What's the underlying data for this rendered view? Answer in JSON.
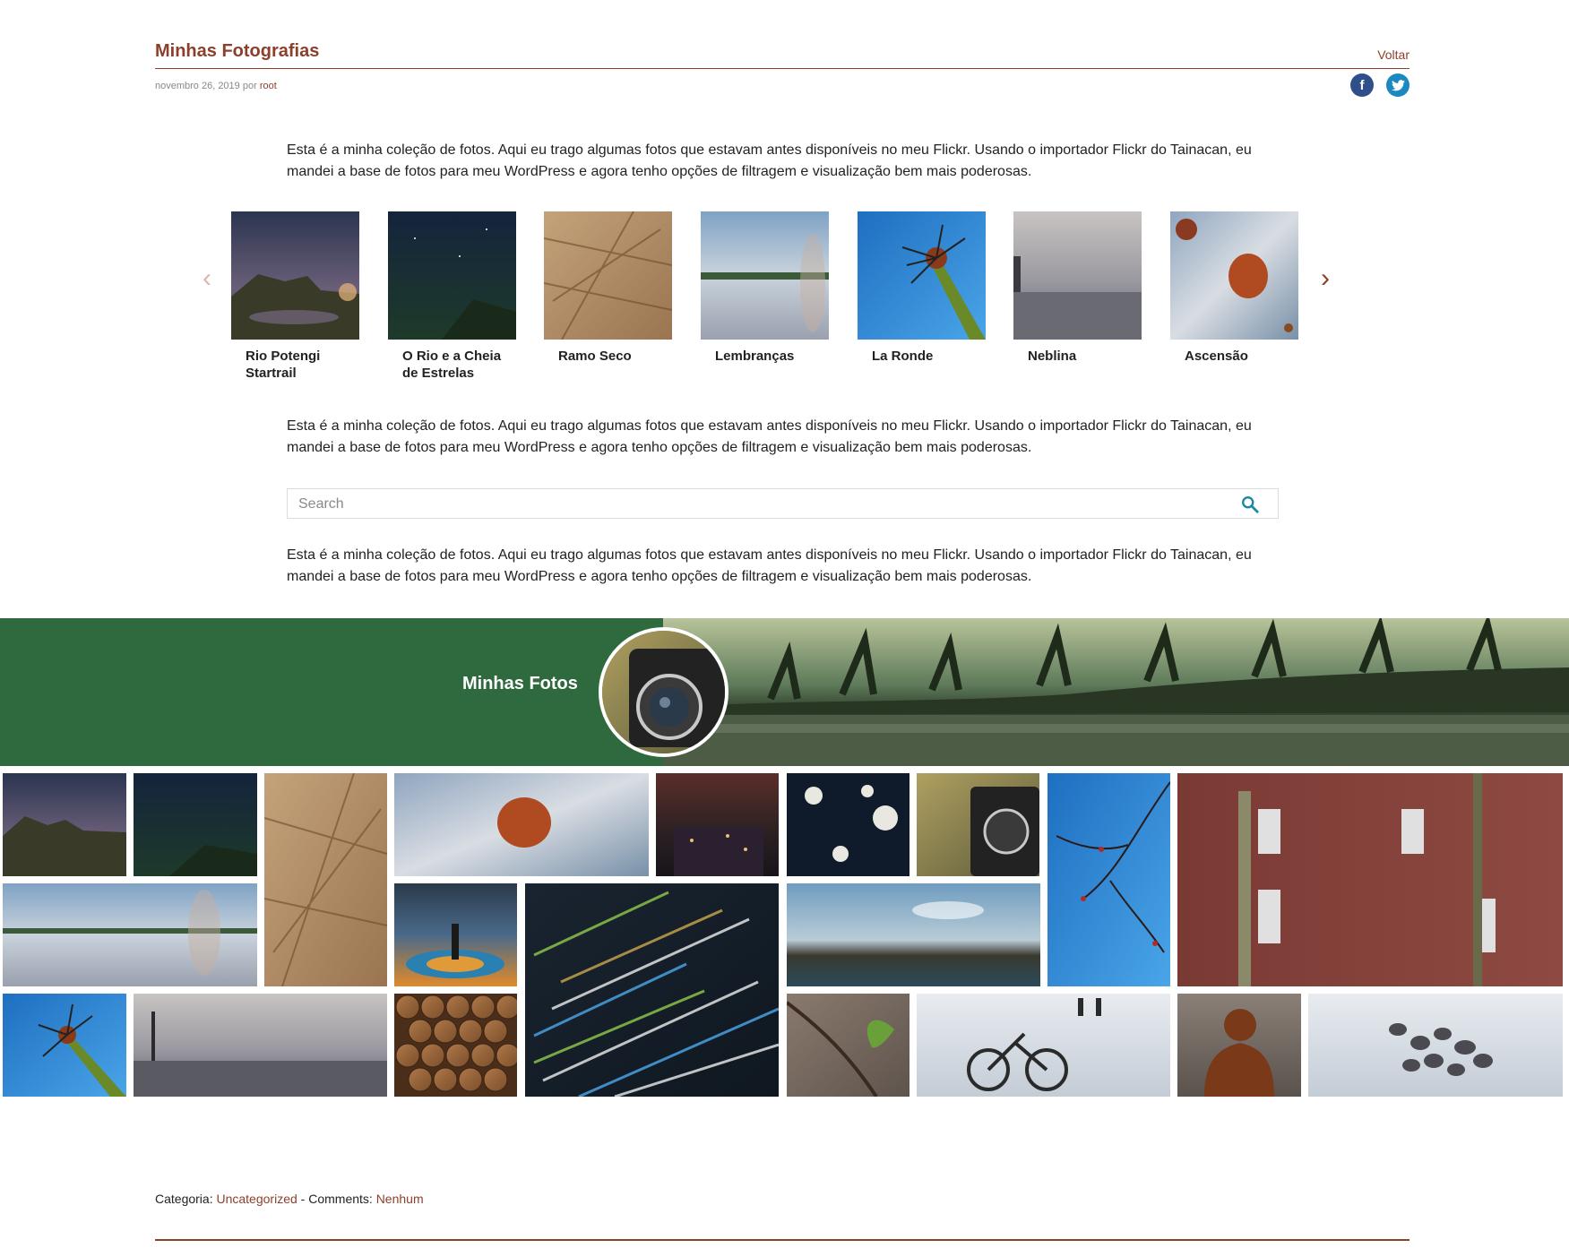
{
  "post": {
    "title": "Minhas Fotografias",
    "back_label": "Voltar",
    "date": "novembro 26, 2019",
    "by": "por",
    "author": "root",
    "social": [
      "facebook-icon",
      "twitter-icon"
    ]
  },
  "description": "Esta é a minha coleção de fotos. Aqui eu trago algumas fotos que estavam antes disponíveis no meu Flickr. Usando o importador Flickr do Tainacan, eu mandei a base de fotos para meu WordPress e agora tenho opções de filtragem e visualização bem mais poderosas.",
  "carousel": {
    "items": [
      {
        "label": "Rio Potengi Startrail"
      },
      {
        "label": "O Rio e a Cheia de Estrelas"
      },
      {
        "label": "Ramo Seco"
      },
      {
        "label": "Lembranças"
      },
      {
        "label": "La Ronde"
      },
      {
        "label": "Neblina"
      },
      {
        "label": "Ascensão"
      }
    ]
  },
  "search": {
    "placeholder": "Search"
  },
  "collection": {
    "title": "Minhas Fotos"
  },
  "footer": {
    "category_label": "Categoria:",
    "category": "Uncategorized",
    "separator": "-",
    "comments_label": "Comments:",
    "comments": "Nenhum"
  }
}
